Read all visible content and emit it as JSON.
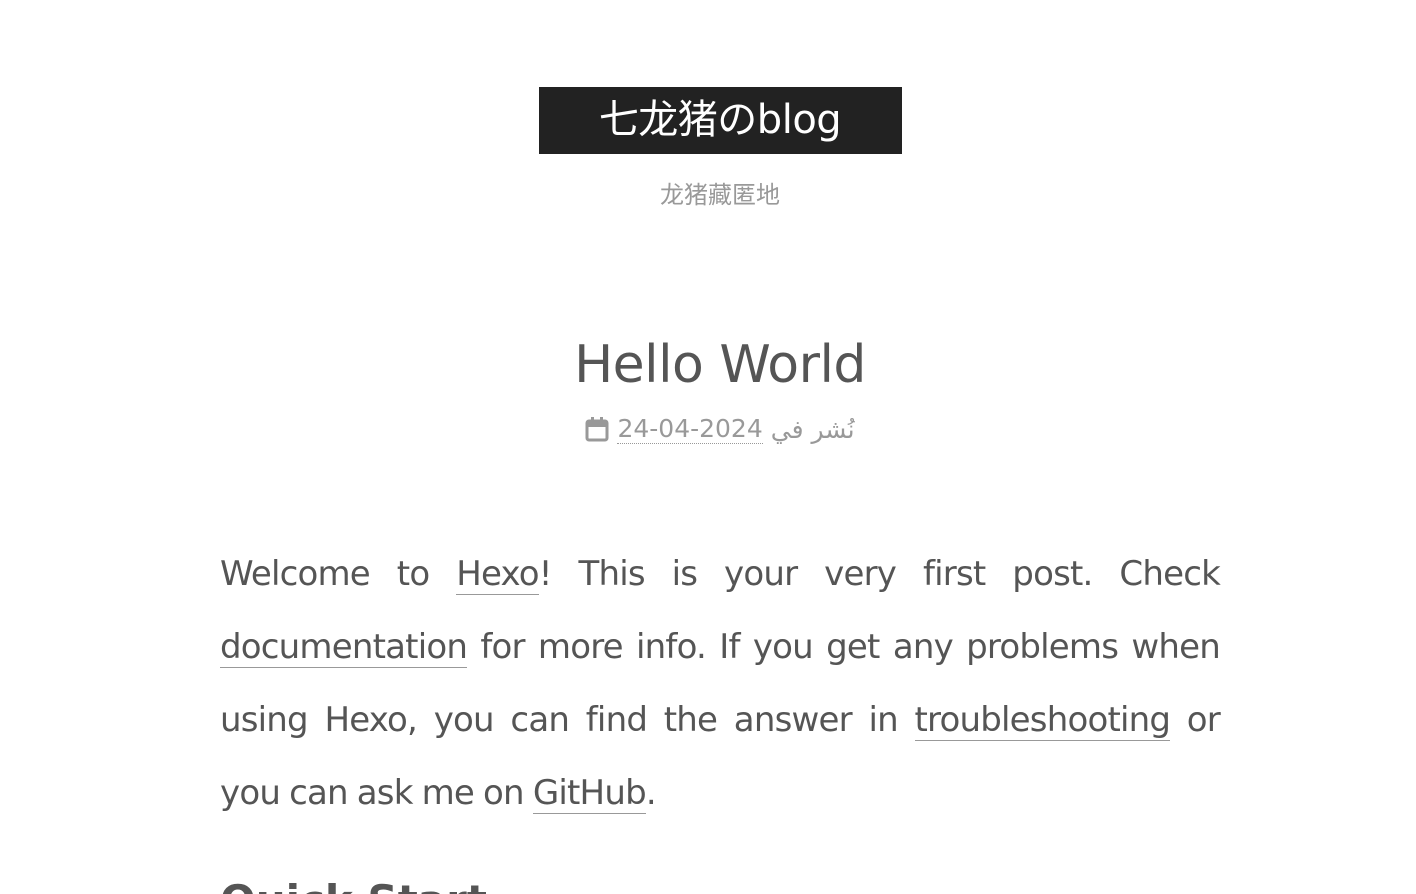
{
  "site": {
    "title": "七龙猪のblog",
    "subtitle": "龙猪藏匿地"
  },
  "post": {
    "title": "Hello World",
    "meta_label": "نُشر في",
    "date": "24-04-2024",
    "icon": "calendar-icon",
    "body": {
      "t1": "Welcome to ",
      "link_hexo": "Hexo",
      "t2": "! This is your very first post. Check ",
      "link_documentation": "documentation",
      "t3": " for more info. If you get any problems when using Hexo, you can find the answer in ",
      "link_troubleshooting": "troubleshooting",
      "t4": " or you can ask me on ",
      "link_github": "GitHub",
      "t5": "."
    },
    "next_heading": "Quick Start"
  },
  "colors": {
    "title_bg": "#222222",
    "text": "#555555",
    "muted": "#999999"
  }
}
